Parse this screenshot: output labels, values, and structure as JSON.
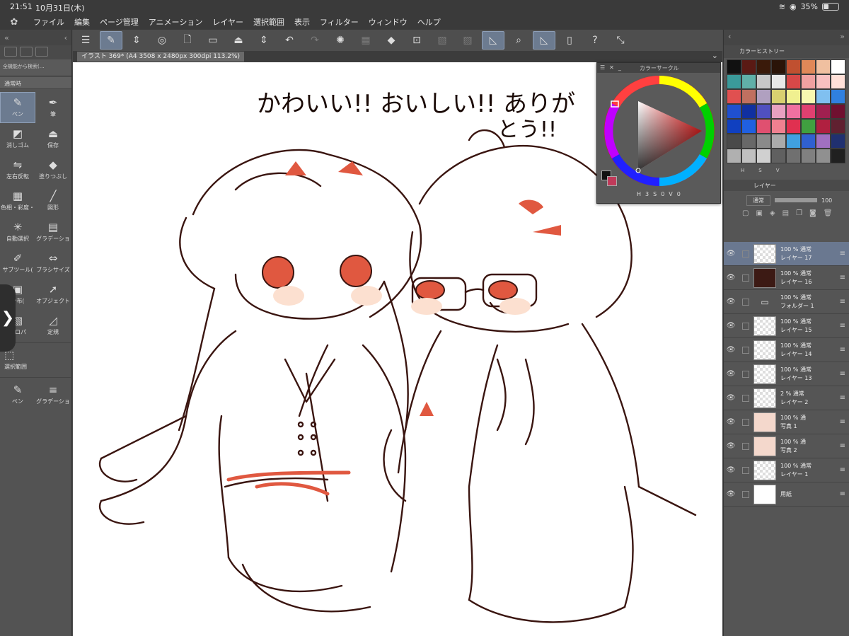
{
  "status": {
    "time": "21:51",
    "date": "10月31日(木)",
    "battery": "35%"
  },
  "menu": [
    "ファイル",
    "編集",
    "ページ管理",
    "アニメーション",
    "レイヤー",
    "選択範囲",
    "表示",
    "フィルター",
    "ウィンドウ",
    "ヘルプ"
  ],
  "left": {
    "search": "全機能から検索(…",
    "mode": "通常時",
    "tools": [
      {
        "label": "ペン",
        "icon": "✎",
        "sel": true
      },
      {
        "label": "筆",
        "icon": "✒"
      },
      {
        "label": "消しゴム",
        "icon": "◩"
      },
      {
        "label": "保存",
        "icon": "⏏"
      },
      {
        "label": "左右反転",
        "icon": "⇋"
      },
      {
        "label": "塗りつぶし",
        "icon": "◆"
      },
      {
        "label": "色相・彩度・",
        "icon": "▦"
      },
      {
        "label": "図形",
        "icon": "╱"
      },
      {
        "label": "自動選択",
        "icon": "✳"
      },
      {
        "label": "グラデーショ",
        "icon": "▤"
      },
      {
        "label": "サブツール(",
        "icon": "✐"
      },
      {
        "label": "ブラシサイズ",
        "icon": "⇔"
      },
      {
        "label": "分布(",
        "icon": "▣"
      },
      {
        "label": "オブジェクト",
        "icon": "➚"
      },
      {
        "label": "プロパ",
        "icon": "▧"
      },
      {
        "label": "定規",
        "icon": "◿"
      }
    ],
    "select_label": "選択範囲",
    "bottom_tools": [
      {
        "label": "ペン",
        "icon": "✎"
      },
      {
        "label": "グラデーショ",
        "icon": "≡"
      }
    ]
  },
  "canvas_tab": "イラスト 369* (A4 3508 x 2480px 300dpi 113.2%)",
  "drawing_text_line1": "かわいい!! おいしい!! ありが",
  "drawing_text_line2": "とう!!",
  "color_circle": {
    "title": "カラーサークル",
    "h": "3",
    "s": "0",
    "v": "0"
  },
  "right": {
    "history_tab": "カラーヒストリー",
    "swatches": [
      "#111111",
      "#5a1a14",
      "#3a1a0a",
      "#2a1408",
      "#c05030",
      "#e08858",
      "#f0c0a0",
      "#ffffff",
      "#3a9a9a",
      "#60b0a8",
      "#c8c8c8",
      "#e8e8e8",
      "#d84848",
      "#f0a0a0",
      "#f8c0c0",
      "#ffe0d8",
      "#e05050",
      "#c07060",
      "#b0a0c0",
      "#d8d070",
      "#f0f090",
      "#f8f8b0",
      "#80c0f0",
      "#3080e0",
      "#2050d0",
      "#1030a0",
      "#5050c0",
      "#e8a0c0",
      "#f070a0",
      "#e04070",
      "#a02050",
      "#701030",
      "#1040c0",
      "#2060e0",
      "#e05070",
      "#f08090",
      "#e03050",
      "#40a040",
      "#b02040",
      "#602030",
      "#4a4a4a",
      "#686868",
      "#8a8a8a",
      "#aaaaaa",
      "#40a0e0",
      "#3060d0",
      "#a070c0",
      "#203070",
      "#b0b0b0",
      "#c0c0c0",
      "#d0d0d0",
      "#606060",
      "#707070",
      "#808080",
      "#909090",
      "#202020"
    ],
    "hsv_labels": [
      "H",
      "S",
      "V"
    ],
    "layer_tab": "レイヤー",
    "blend_mode": "通常",
    "opacity": "100",
    "layers": [
      {
        "pct": "100 % 通常",
        "name": "レイヤー 17",
        "thumb": "check",
        "sel": true
      },
      {
        "pct": "100 % 通常",
        "name": "レイヤー 16",
        "thumb": "dark"
      },
      {
        "pct": "100 % 通常",
        "name": "フォルダー 1",
        "thumb": "folder"
      },
      {
        "pct": "100 % 通常",
        "name": "レイヤー 15",
        "thumb": "check"
      },
      {
        "pct": "100 % 通常",
        "name": "レイヤー 14",
        "thumb": "check"
      },
      {
        "pct": "100 % 通常",
        "name": "レイヤー 13",
        "thumb": "check"
      },
      {
        "pct": "2 % 通常",
        "name": "レイヤー 2",
        "thumb": "check"
      },
      {
        "pct": "100 % 通",
        "name": "写真 1",
        "thumb": "photo"
      },
      {
        "pct": "100 % 通",
        "name": "写真 2",
        "thumb": "photo"
      },
      {
        "pct": "100 % 通常",
        "name": "レイヤー 1",
        "thumb": "check"
      },
      {
        "pct": "",
        "name": "用紙",
        "thumb": "white"
      }
    ]
  }
}
